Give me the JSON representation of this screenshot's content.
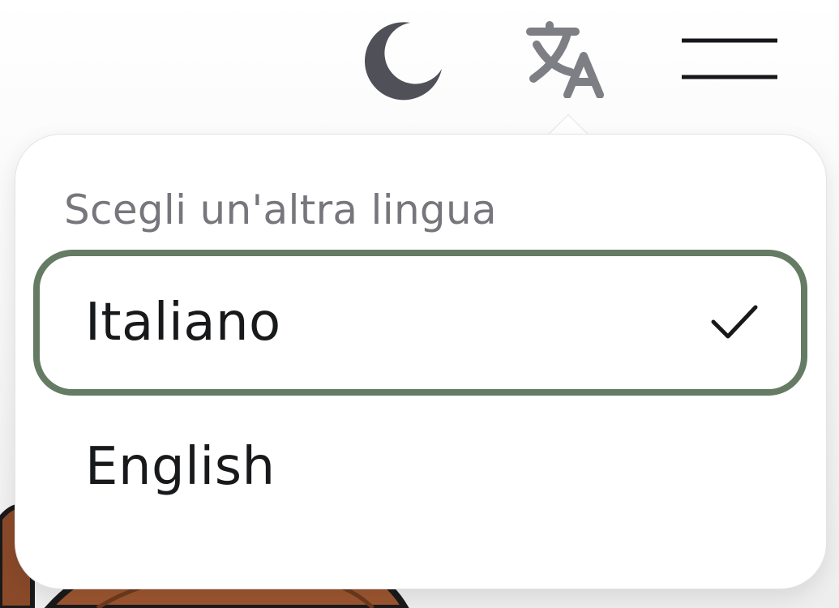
{
  "header": {
    "theme_toggle": {
      "icon": "moon-icon",
      "color": "#4f5058"
    },
    "language_button": {
      "icon": "translate-icon",
      "color": "#7e7e85"
    },
    "menu_button": {
      "icon": "hamburger-icon",
      "color": "#15171a"
    }
  },
  "language_menu": {
    "heading": "Scegli un'altra lingua",
    "options": [
      {
        "label": "Italiano",
        "selected": true
      },
      {
        "label": "English",
        "selected": false
      }
    ],
    "selected_border_color": "#657b63",
    "check_icon": "check-icon"
  }
}
